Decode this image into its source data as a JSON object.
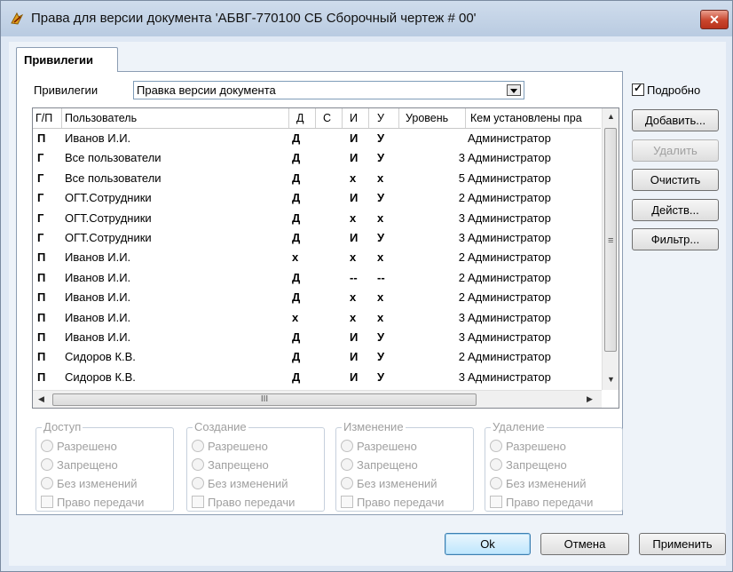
{
  "window": {
    "title": "Права для версии документа 'АБВГ-770100 СБ Сборочный чертеж  # 00'",
    "close_label": "✕"
  },
  "tab": {
    "label": "Привилегии"
  },
  "privileges": {
    "label": "Привилегии",
    "selected": "Правка версии документа"
  },
  "detail_checkbox": {
    "label": "Подробно",
    "checked": true
  },
  "side_buttons": {
    "add": "Добавить...",
    "delete": "Удалить",
    "clear": "Очистить",
    "actions": "Действ...",
    "filter": "Фильтр..."
  },
  "grid": {
    "columns": [
      "Г/П",
      "Пользователь",
      "Д",
      "С",
      "И",
      "У",
      "Уровень",
      "Кем установлены пра"
    ],
    "rows": [
      [
        "П",
        "Иванов И.И.",
        "Д",
        "",
        "И",
        "У",
        "",
        "Администратор"
      ],
      [
        "Г",
        "Все пользователи",
        "Д",
        "",
        "И",
        "У",
        "3",
        "Администратор"
      ],
      [
        "Г",
        "Все пользователи",
        "Д",
        "",
        "х",
        "х",
        "5",
        "Администратор"
      ],
      [
        "Г",
        "ОГТ.Сотрудники",
        "Д",
        "",
        "И",
        "У",
        "2",
        "Администратор"
      ],
      [
        "Г",
        "ОГТ.Сотрудники",
        "Д",
        "",
        "х",
        "х",
        "3",
        "Администратор"
      ],
      [
        "Г",
        "ОГТ.Сотрудники",
        "Д",
        "",
        "И",
        "У",
        "3",
        "Администратор"
      ],
      [
        "П",
        "Иванов И.И.",
        "х",
        "",
        "х",
        "х",
        "2",
        "Администратор"
      ],
      [
        "П",
        "Иванов И.И.",
        "Д",
        "",
        "--",
        "--",
        "2",
        "Администратор"
      ],
      [
        "П",
        "Иванов И.И.",
        "Д",
        "",
        "х",
        "х",
        "2",
        "Администратор"
      ],
      [
        "П",
        "Иванов И.И.",
        "х",
        "",
        "х",
        "х",
        "3",
        "Администратор"
      ],
      [
        "П",
        "Иванов И.И.",
        "Д",
        "",
        "И",
        "У",
        "3",
        "Администратор"
      ],
      [
        "П",
        "Сидоров К.В.",
        "Д",
        "",
        "И",
        "У",
        "2",
        "Администратор"
      ],
      [
        "П",
        "Сидоров К.В.",
        "Д",
        "",
        "И",
        "У",
        "3",
        "Администратор"
      ]
    ],
    "hscroll_grip": "III",
    "vscroll_grip": "≡"
  },
  "groups": [
    {
      "title": "Доступ",
      "options": [
        "Разрешено",
        "Запрещено",
        "Без изменений"
      ],
      "check": "Право передачи"
    },
    {
      "title": "Создание",
      "options": [
        "Разрешено",
        "Запрещено",
        "Без изменений"
      ],
      "check": "Право передачи"
    },
    {
      "title": "Изменение",
      "options": [
        "Разрешено",
        "Запрещено",
        "Без изменений"
      ],
      "check": "Право передачи"
    },
    {
      "title": "Удаление",
      "options": [
        "Разрешено",
        "Запрещено",
        "Без изменений"
      ],
      "check": "Право передачи"
    }
  ],
  "footer": {
    "ok": "Ok",
    "cancel": "Отмена",
    "apply": "Применить"
  }
}
